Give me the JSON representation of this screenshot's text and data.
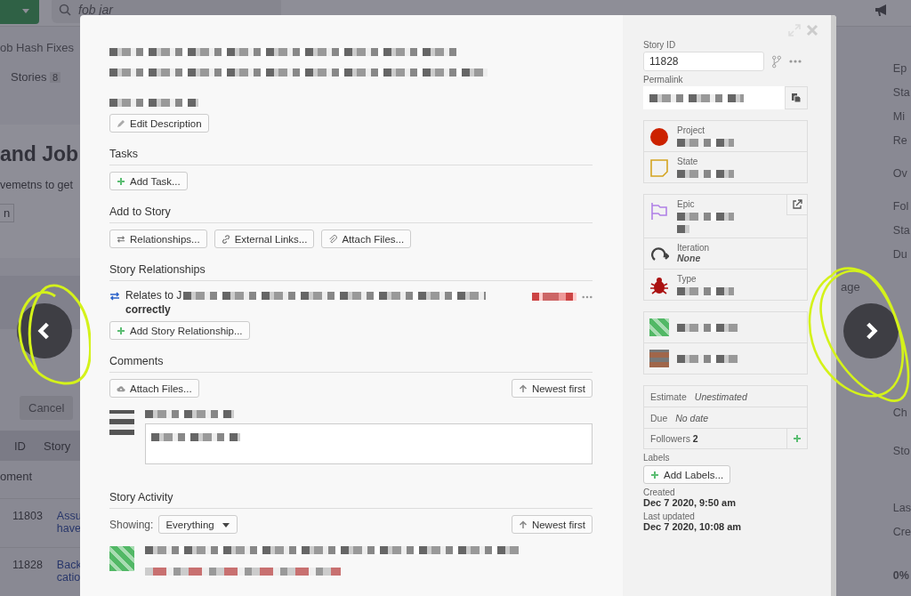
{
  "background": {
    "search_value": "fob jar",
    "breadcrumb": "ob Hash Fixes",
    "stories_tab": {
      "label": "Stories",
      "count": "8"
    },
    "heading": "and Job",
    "description": "vemetns to get",
    "button_fragment": "n",
    "cancel_button": "Cancel",
    "columns": [
      "ID",
      "Story"
    ],
    "group_label": "oment",
    "rows": [
      {
        "id": "11803",
        "title": [
          "Assu",
          "have"
        ]
      },
      {
        "id": "11828",
        "title": [
          "Back",
          "catio"
        ]
      }
    ],
    "field_fragment": "age",
    "right_labels": [
      "Ep",
      "Sta",
      "Mi",
      "Re",
      "Ov",
      "Fol",
      "Sta",
      "Du",
      "Ch",
      "Sto",
      "Las",
      "Cre",
      "0%"
    ]
  },
  "story": {
    "edit_description": "Edit Description",
    "tasks": {
      "heading": "Tasks",
      "add_button": "Add Task..."
    },
    "add_to_story": {
      "heading": "Add to Story",
      "buttons": [
        "Relationships...",
        "External Links...",
        "Attach Files..."
      ]
    },
    "relationships": {
      "heading": "Story Relationships",
      "relation_prefix": "Relates to J",
      "relation_suffix": "correctly",
      "add_button": "Add Story Relationship..."
    },
    "comments": {
      "heading": "Comments",
      "attach_button": "Attach Files...",
      "sort_button": "Newest first"
    },
    "activity": {
      "heading": "Story Activity",
      "showing_label": "Showing:",
      "filter": "Everything",
      "sort_button": "Newest first"
    }
  },
  "sidebar": {
    "story_id_label": "Story ID",
    "story_id": "11828",
    "permalink_label": "Permalink",
    "fields": [
      {
        "kind": "project",
        "label": "Project"
      },
      {
        "kind": "state",
        "label": "State"
      }
    ],
    "details": [
      {
        "kind": "epic",
        "label": "Epic"
      },
      {
        "kind": "iteration",
        "label": "Iteration",
        "value": "None"
      },
      {
        "kind": "type",
        "label": "Type"
      }
    ],
    "estimate": {
      "label": "Estimate",
      "value": "Unestimated"
    },
    "due": {
      "label": "Due",
      "value": "No date"
    },
    "followers": {
      "label": "Followers",
      "value": "2"
    },
    "labels_label": "Labels",
    "add_labels": "Add Labels...",
    "created_label": "Created",
    "created": "Dec 7 2020, 9:50 am",
    "updated_label": "Last updated",
    "updated": "Dec 7 2020, 10:08 am"
  }
}
